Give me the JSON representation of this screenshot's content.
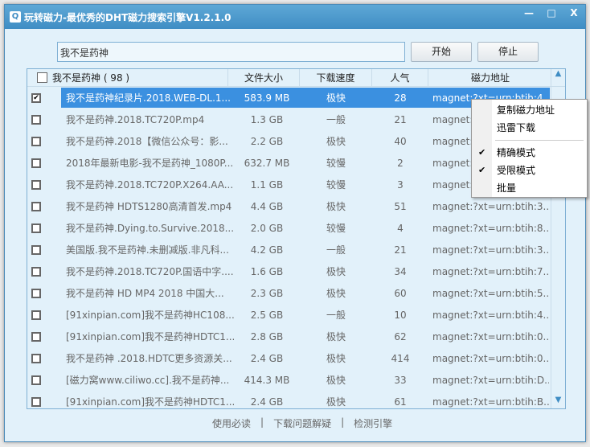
{
  "window": {
    "title": "玩转磁力-最优秀的DHT磁力搜索引擎V1.2.1.0",
    "controls": [
      "—",
      "□",
      "X"
    ]
  },
  "search": {
    "value": "我不是药神",
    "start_label": "开始",
    "stop_label": "停止"
  },
  "table": {
    "headers": {
      "name": "我不是药神 ( 98 )",
      "size": "文件大小",
      "speed": "下载速度",
      "popularity": "人气",
      "magnet": "磁力地址"
    },
    "rows": [
      {
        "checked": true,
        "name": "我不是药神纪录片.2018.WEB-DL.1...",
        "size": "583.9 MB",
        "speed": "极快",
        "pop": "28",
        "magnet": "magnet:?xt=urn:btih:4..."
      },
      {
        "checked": false,
        "name": "我不是药神.2018.TC720P.mp4",
        "size": "1.3 GB",
        "speed": "一般",
        "pop": "21",
        "magnet": "magnet:"
      },
      {
        "checked": false,
        "name": "我不是药神.2018【微信公众号：影...",
        "size": "2.2 GB",
        "speed": "极快",
        "pop": "40",
        "magnet": "magnet:"
      },
      {
        "checked": false,
        "name": "2018年最新电影-我不是药神_1080P...",
        "size": "632.7 MB",
        "speed": "较慢",
        "pop": "2",
        "magnet": "magnet:"
      },
      {
        "checked": false,
        "name": "我不是药神.2018.TC720P.X264.AA...",
        "size": "1.1 GB",
        "speed": "较慢",
        "pop": "3",
        "magnet": "magnet:"
      },
      {
        "checked": false,
        "name": "我不是药神 HDTS1280高清首发.mp4",
        "size": "4.4 GB",
        "speed": "极快",
        "pop": "51",
        "magnet": "magnet:?xt=urn:btih:3..."
      },
      {
        "checked": false,
        "name": "我不是药神.Dying.to.Survive.2018....",
        "size": "2.0 GB",
        "speed": "较慢",
        "pop": "4",
        "magnet": "magnet:?xt=urn:btih:8..."
      },
      {
        "checked": false,
        "name": "美国版.我不是药神.未删减版.非凡科...",
        "size": "4.2 GB",
        "speed": "一般",
        "pop": "21",
        "magnet": "magnet:?xt=urn:btih:3..."
      },
      {
        "checked": false,
        "name": "我不是药神.2018.TC720P.国语中字....",
        "size": "1.6 GB",
        "speed": "极快",
        "pop": "34",
        "magnet": "magnet:?xt=urn:btih:7..."
      },
      {
        "checked": false,
        "name": "我不是药神 HD MP4 2018 中国大...",
        "size": "2.3 GB",
        "speed": "极快",
        "pop": "60",
        "magnet": "magnet:?xt=urn:btih:5..."
      },
      {
        "checked": false,
        "name": "[91xinpian.com]我不是药神HC108...",
        "size": "2.5 GB",
        "speed": "一般",
        "pop": "10",
        "magnet": "magnet:?xt=urn:btih:4..."
      },
      {
        "checked": false,
        "name": "[91xinpian.com]我不是药神HDTC1...",
        "size": "2.8 GB",
        "speed": "极快",
        "pop": "62",
        "magnet": "magnet:?xt=urn:btih:0..."
      },
      {
        "checked": false,
        "name": "我不是药神 .2018.HDTC更多资源关...",
        "size": "2.4 GB",
        "speed": "极快",
        "pop": "414",
        "magnet": "magnet:?xt=urn:btih:0..."
      },
      {
        "checked": false,
        "name": "[磁力窝www.ciliwo.cc].我不是药神...",
        "size": "414.3 MB",
        "speed": "极快",
        "pop": "33",
        "magnet": "magnet:?xt=urn:btih:D..."
      },
      {
        "checked": false,
        "name": "[91xinpian.com]我不是药神HDTC1...",
        "size": "2.4 GB",
        "speed": "极快",
        "pop": "61",
        "magnet": "magnet:?xt=urn:btih:B..."
      }
    ]
  },
  "context_menu": {
    "items": [
      {
        "label": "复制磁力地址",
        "checked": false
      },
      {
        "label": "迅雷下载",
        "checked": false
      },
      {
        "separator": true
      },
      {
        "label": "精确模式",
        "checked": true
      },
      {
        "label": "受限模式",
        "checked": true
      },
      {
        "label": "批量",
        "checked": false
      }
    ]
  },
  "footer": {
    "links": [
      "使用必读",
      "下载问题解疑",
      "检测引擎"
    ],
    "separator": "|"
  },
  "colors": {
    "titlebar": "#3f8dc4",
    "selection": "#3b90e0",
    "background": "#e2f1fa"
  }
}
